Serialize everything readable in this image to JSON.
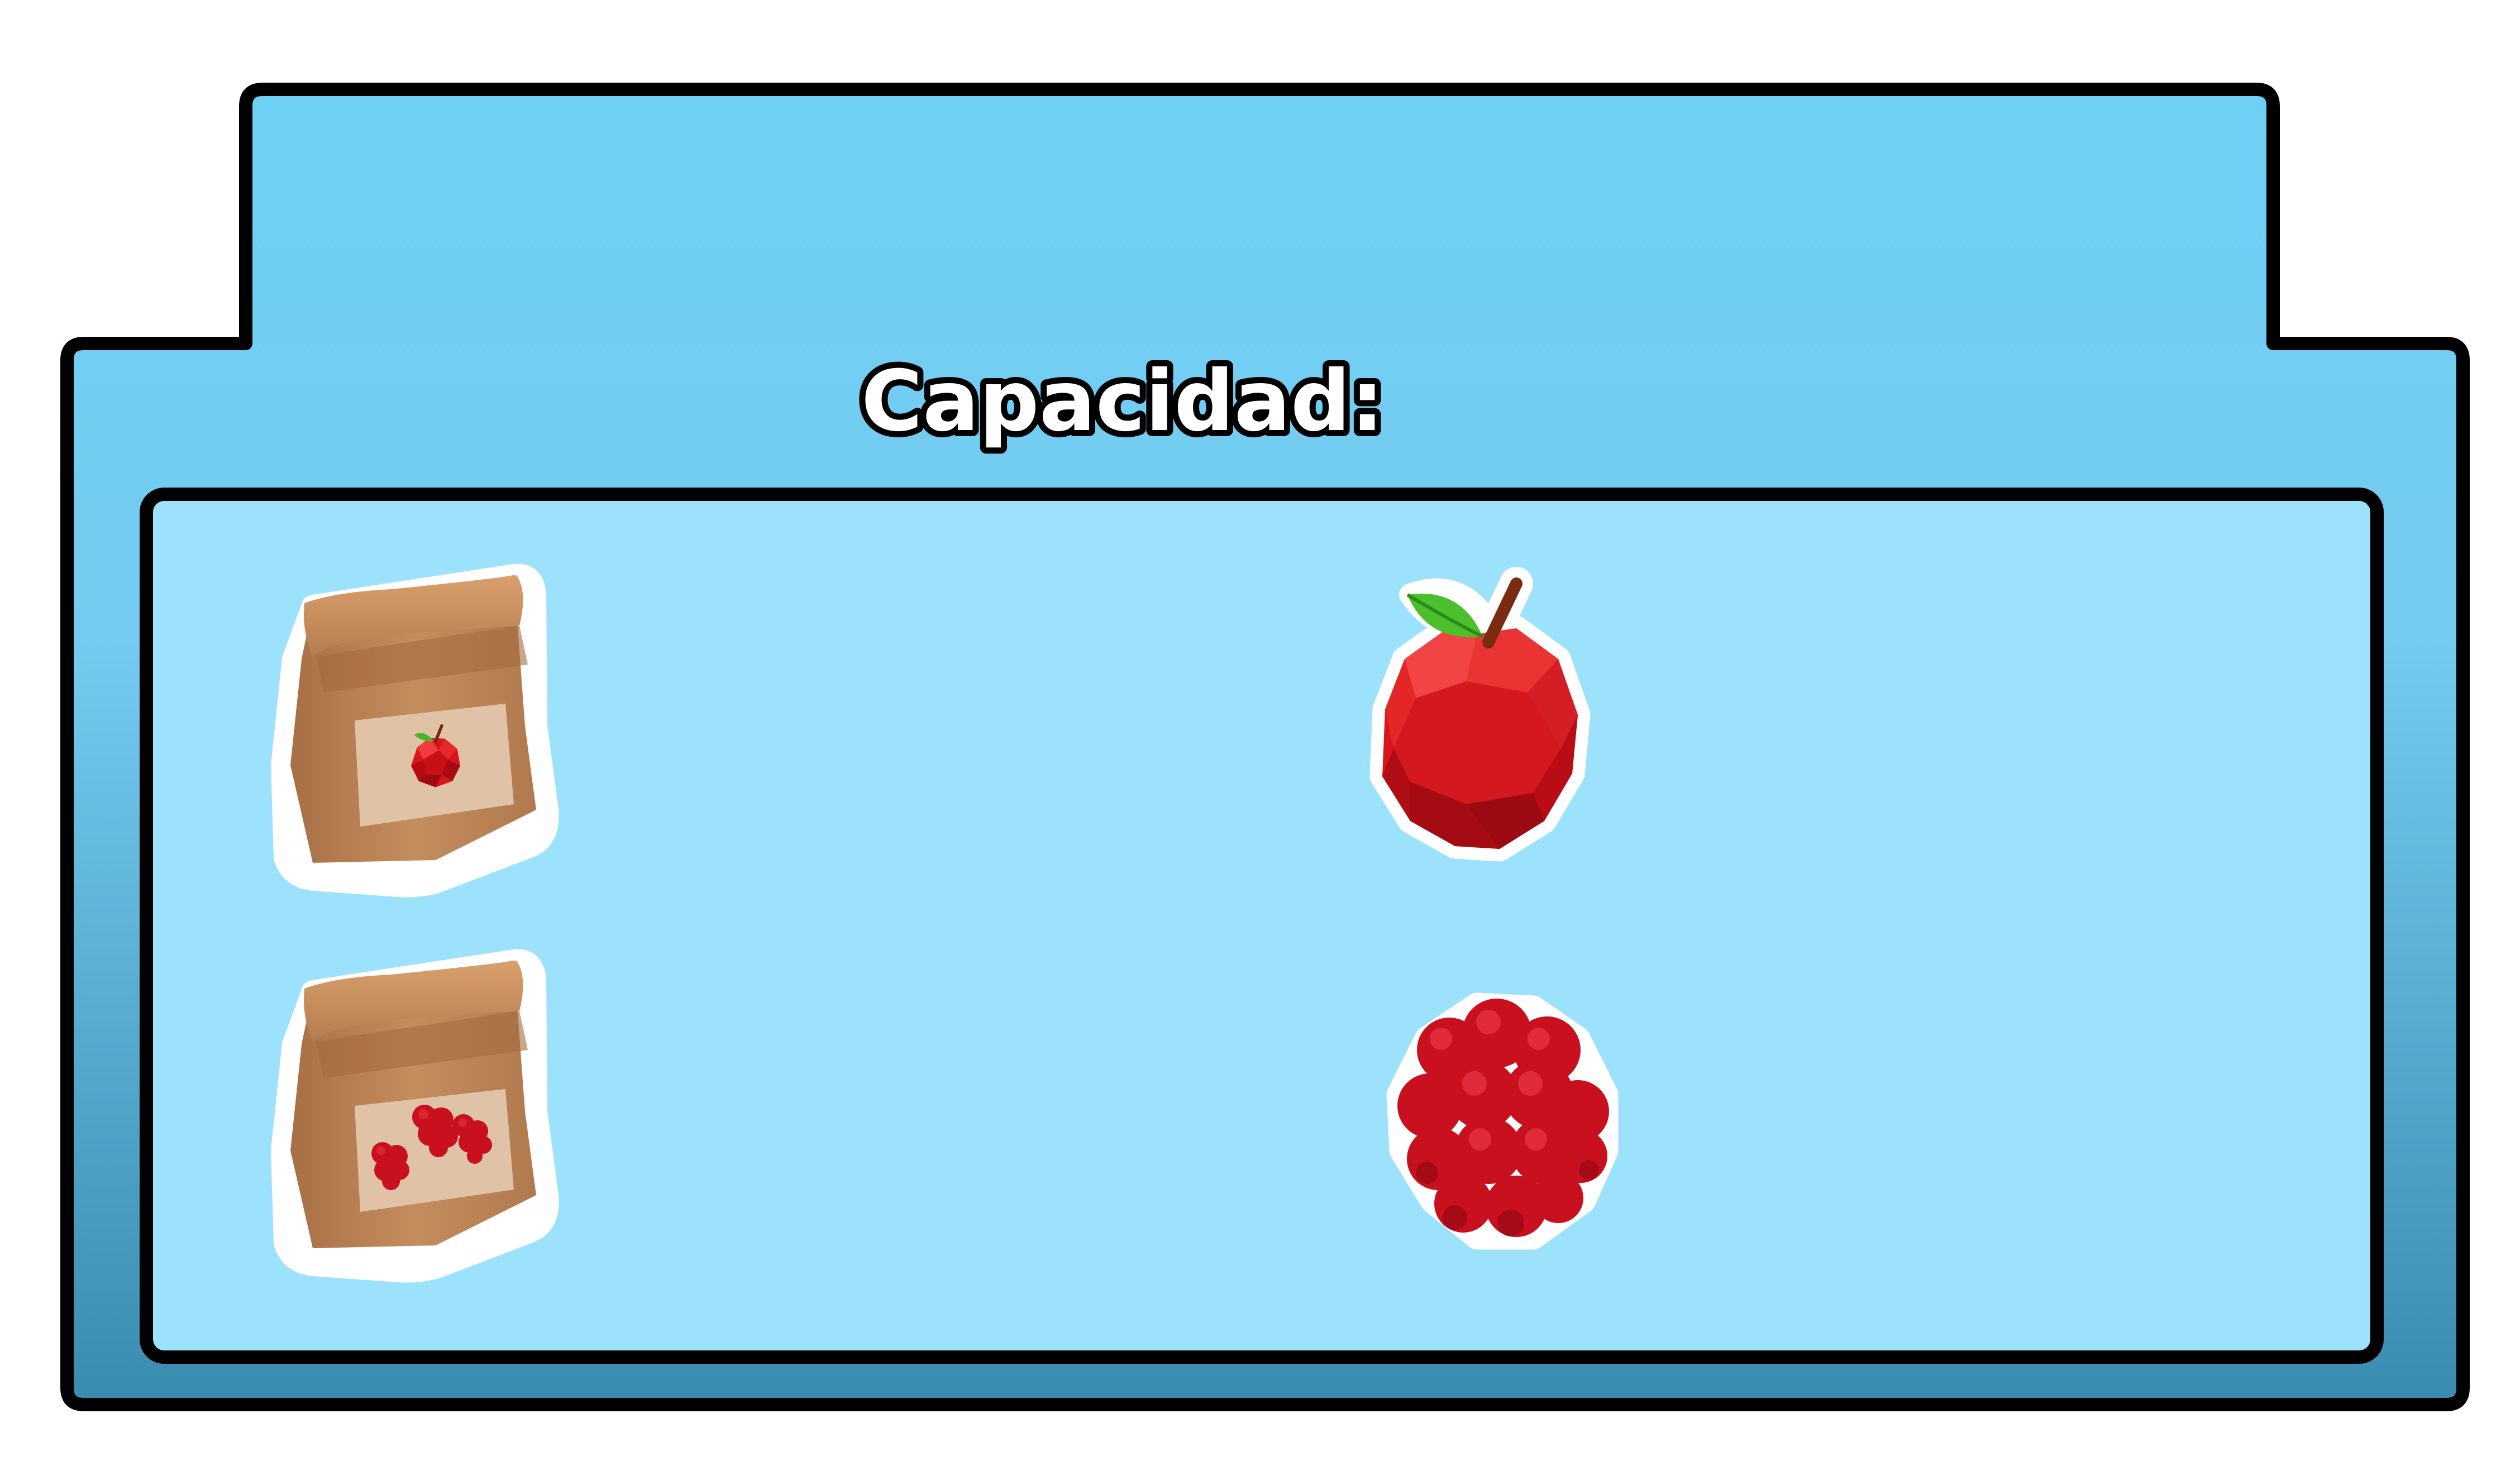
{
  "panel": {
    "title": "Capacidad:",
    "colors": {
      "outer_top": "#6fd0f5",
      "outer_bottom": "#3a8bb0",
      "inner": "#9de2fd",
      "outline": "#000000",
      "title_fill": "#ffffff",
      "title_outline": "#000000"
    }
  },
  "rows": [
    {
      "left_icon": "seed-bag-apple-icon",
      "right_icon": "apple-icon"
    },
    {
      "left_icon": "seed-bag-raspberry-icon",
      "right_icon": "raspberry-icon"
    }
  ]
}
